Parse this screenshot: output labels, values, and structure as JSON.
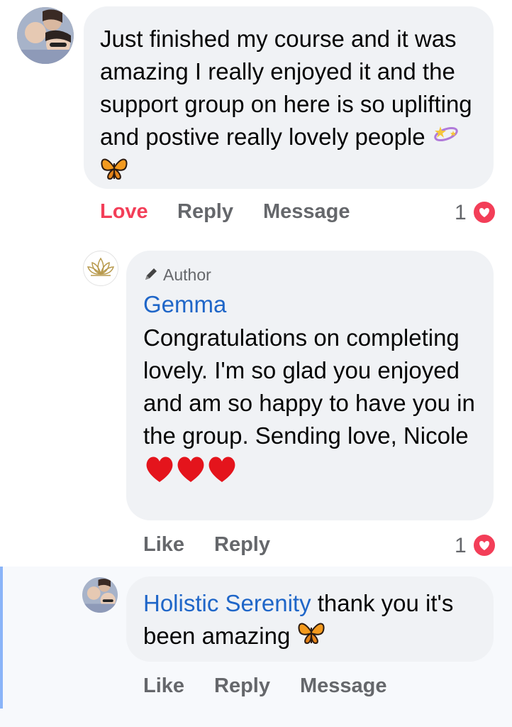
{
  "comment1": {
    "text": "Just finished my course and it was amazing I really enjoyed it and the support group on here is so uplifting and postive really lovely people",
    "actions": {
      "love": "Love",
      "reply": "Reply",
      "message": "Message"
    },
    "reaction_count": "1"
  },
  "comment2": {
    "badge": "Author",
    "name": "Gemma",
    "text": "Congratulations on completing lovely. I'm so glad you enjoyed and am so happy to have you in the group. Sending love, Nicole",
    "actions": {
      "like": "Like",
      "reply": "Reply"
    },
    "reaction_count": "1"
  },
  "comment3": {
    "name": "Holistic Serenity",
    "text": "thank you it's been amazing",
    "actions": {
      "like": "Like",
      "reply": "Reply",
      "message": "Message"
    }
  },
  "colors": {
    "bubble": "#f0f2f5",
    "name": "#1f66c8",
    "love": "#f33e58",
    "muted": "#65676b"
  }
}
